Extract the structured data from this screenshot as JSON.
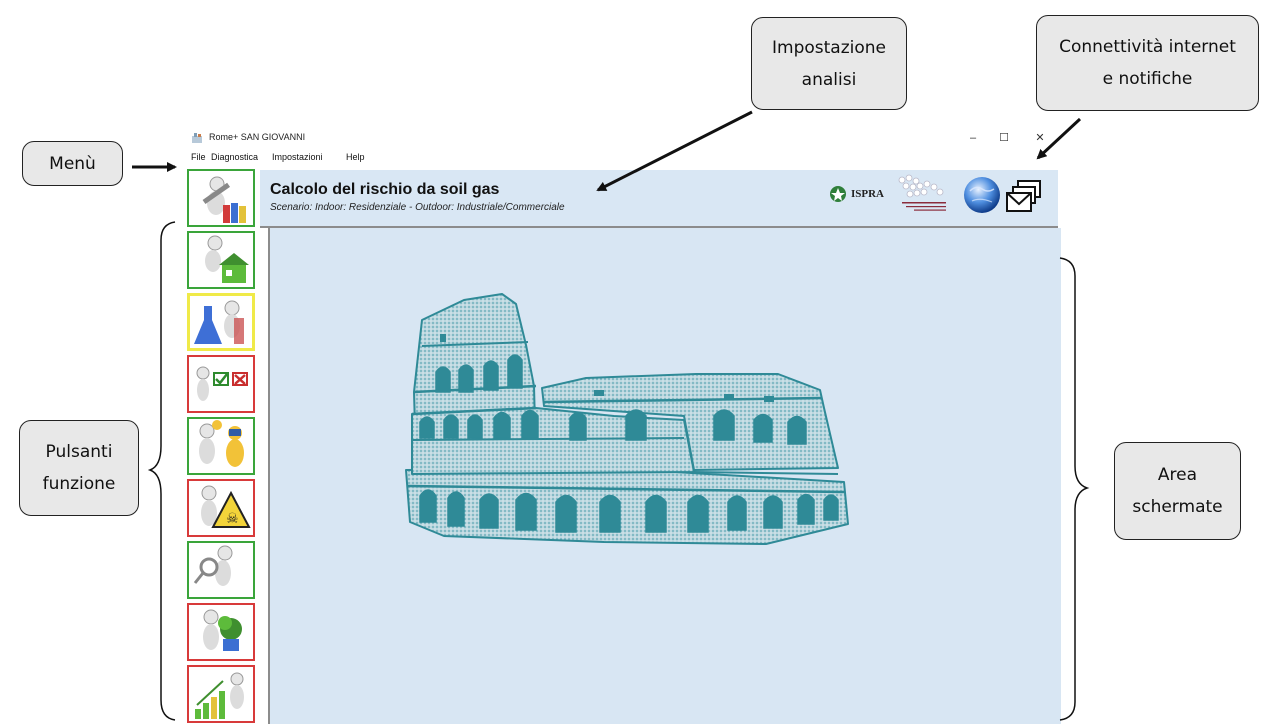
{
  "callouts": {
    "menu": "Menù",
    "analysis": [
      "Impostazione",
      "analisi"
    ],
    "connectivity": [
      "Connettività internet",
      "e notifiche"
    ],
    "buttons": [
      "Pulsanti",
      "funzione"
    ],
    "screen_area": [
      "Area",
      "schermate"
    ]
  },
  "window": {
    "title": "Rome+  SAN GIOVANNI",
    "controls": {
      "minimize": "–",
      "maximize": "☐",
      "close": "✕"
    }
  },
  "menu": [
    "File",
    "Diagnostica",
    "Impostazioni",
    "Help"
  ],
  "header": {
    "title": "Calcolo del rischio da soil gas",
    "scenario": "Scenario:  Indoor: Residenziale - Outdoor: Industriale/Commerciale",
    "ispra_label": "ISPRA"
  },
  "function_buttons": [
    {
      "icon": "tools-books-icon",
      "border": "green"
    },
    {
      "icon": "house-icon",
      "border": "green"
    },
    {
      "icon": "lab-flask-icon",
      "border": "yellow"
    },
    {
      "icon": "checklist-icon",
      "border": "red"
    },
    {
      "icon": "hazmat-worker-icon",
      "border": "green"
    },
    {
      "icon": "hazard-warning-icon",
      "border": "red"
    },
    {
      "icon": "magnifier-icon",
      "border": "green"
    },
    {
      "icon": "plant-icon",
      "border": "red"
    },
    {
      "icon": "growth-chart-icon",
      "border": "red"
    }
  ],
  "colors": {
    "header_bg": "#d9e7f4",
    "screen_bg": "#d8e6f3",
    "green_border": "#3aa53a",
    "red_border": "#d83a3a",
    "yellow_border": "#f0ea48",
    "colosseum": "#4a9aa6"
  }
}
